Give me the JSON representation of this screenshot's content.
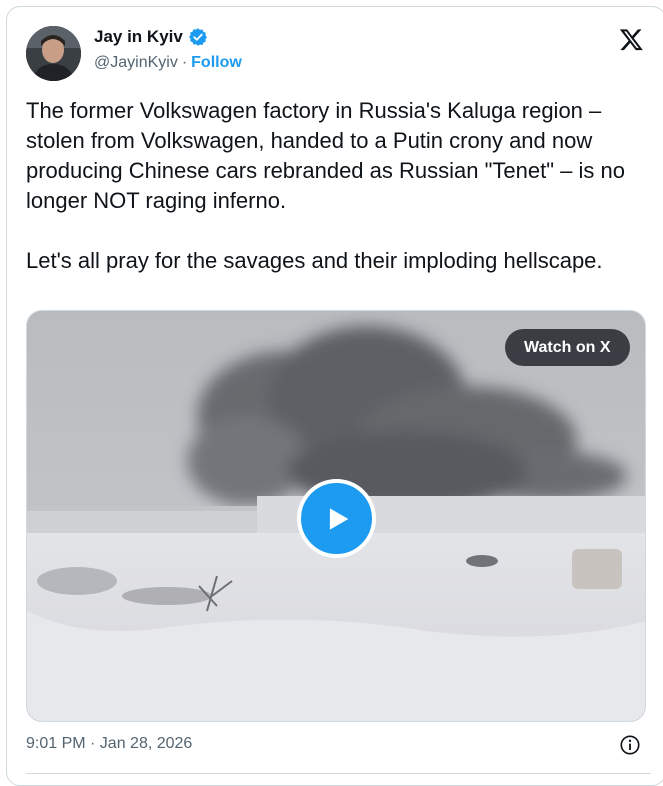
{
  "author": {
    "display_name": "Jay in Kyiv",
    "handle": "@JayinKyiv",
    "separator": "·",
    "follow_label": "Follow",
    "verified": true
  },
  "tweet": {
    "text": "The former Volkswagen factory in Russia's Kaluga region – stolen from Volkswagen, handed to a Putin crony and now producing Chinese cars rebranded as Russian \"Tenet\" – is no longer NOT raging inferno.\n\nLet's all pray for the savages and their imploding hellscape.",
    "timestamp": "9:01 PM · Jan 28, 2026"
  },
  "media": {
    "watch_label": "Watch on X",
    "play_icon": "play-icon"
  },
  "icons": {
    "platform_logo": "x-logo-icon",
    "verified": "verified-badge-icon",
    "info": "info-icon"
  },
  "colors": {
    "accent": "#1d9bf0",
    "text": "#0f1419",
    "secondary": "#536471",
    "border": "#cfd9de"
  }
}
